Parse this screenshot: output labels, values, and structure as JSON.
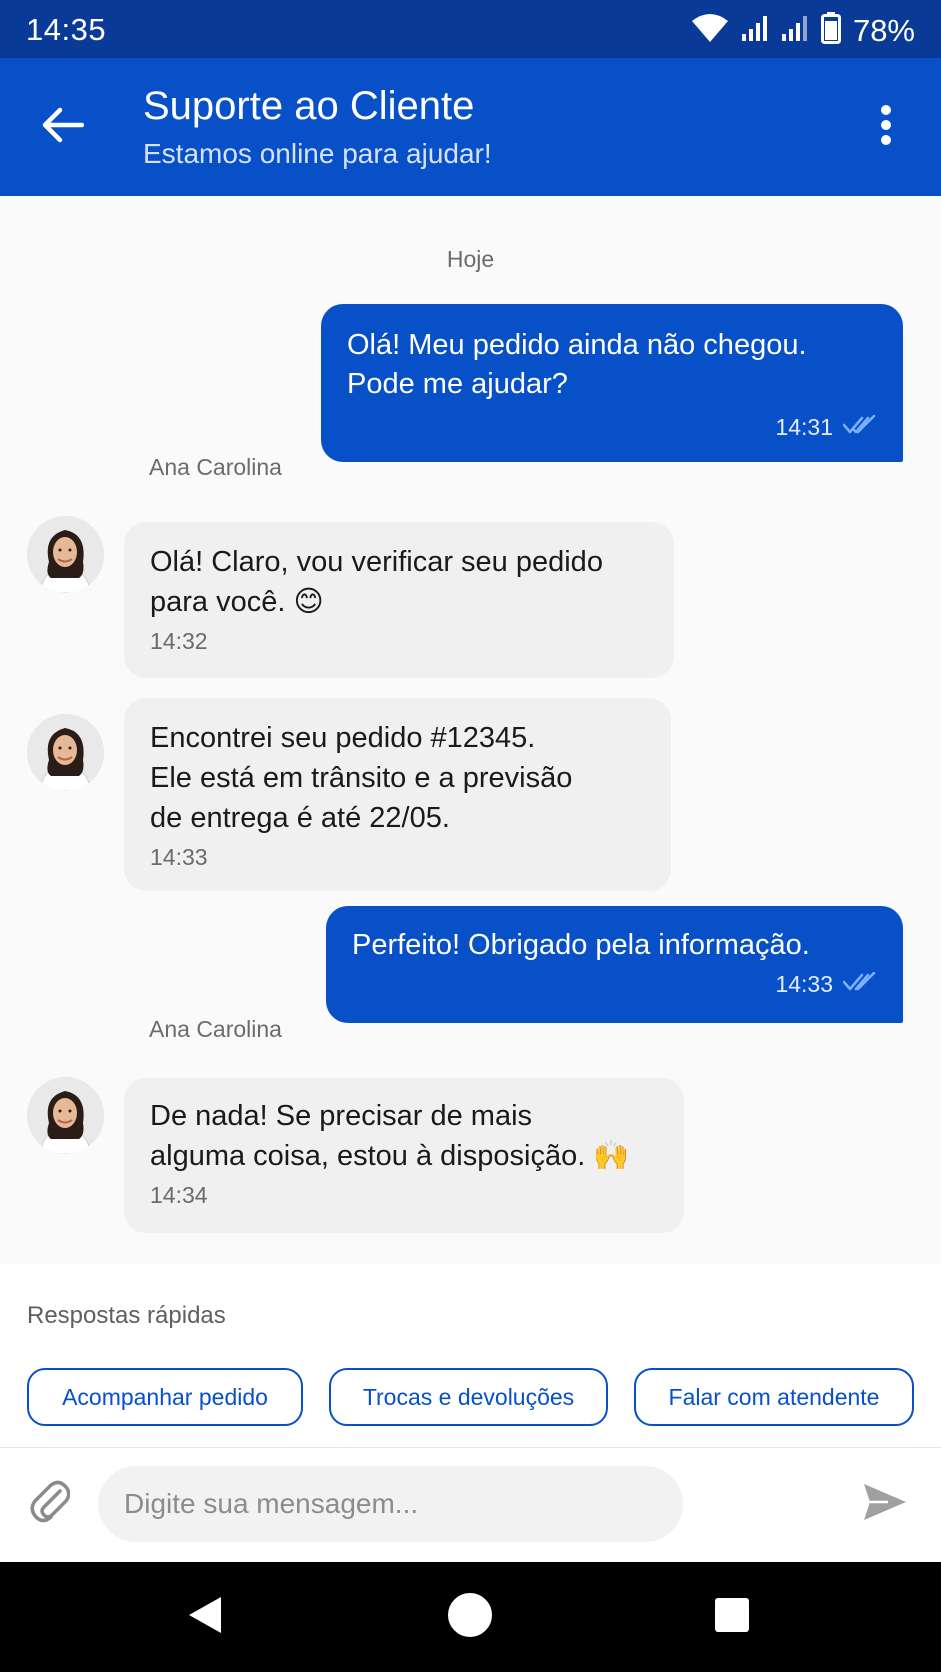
{
  "status_bar": {
    "time": "14:35",
    "battery": "78%",
    "icons": [
      "wifi-icon",
      "signal-icon",
      "signal-icon",
      "battery-icon"
    ]
  },
  "header": {
    "title": "Suporte ao Cliente",
    "subtitle": "Estamos online para ajudar!",
    "back_icon": "arrow-left-icon",
    "menu_icon": "more-vertical-icon"
  },
  "chat": {
    "date_label": "Hoje",
    "messages": [
      {
        "direction": "out",
        "lines": [
          "Olá! Meu pedido ainda não chegou.",
          "Pode me ajudar?"
        ],
        "time": "14:31",
        "status": "read"
      },
      {
        "direction": "in",
        "sender": "Ana Carolina",
        "lines": [
          "Olá! Claro, vou verificar seu pedido",
          "para você. 😊"
        ],
        "time": "14:32"
      },
      {
        "direction": "in",
        "lines": [
          "Encontrei seu pedido #12345.",
          "Ele está em trânsito e a previsão",
          "de entrega é até 22/05."
        ],
        "time": "14:33"
      },
      {
        "direction": "out",
        "lines": [
          "Perfeito! Obrigado pela informação."
        ],
        "time": "14:33",
        "status": "read"
      },
      {
        "direction": "in",
        "sender": "Ana Carolina",
        "lines": [
          "De nada! Se precisar de mais",
          "alguma coisa, estou à disposição. 🙌"
        ],
        "time": "14:34"
      }
    ]
  },
  "quick_replies": {
    "title": "Respostas rápidas",
    "options": [
      "Acompanhar pedido",
      "Trocas e devoluções",
      "Falar com atendente"
    ]
  },
  "composer": {
    "placeholder": "Digite sua mensagem...",
    "attach_icon": "paperclip-icon",
    "send_icon": "send-icon"
  },
  "nav_bar": {
    "buttons": [
      "back-triangle-icon",
      "home-circle-icon",
      "recents-square-icon"
    ]
  },
  "colors": {
    "primary": "#0750c8",
    "status_bar": "#0a3a98",
    "incoming_bubble": "#f0f0f0",
    "read_ticks": "#7fb0ff"
  }
}
